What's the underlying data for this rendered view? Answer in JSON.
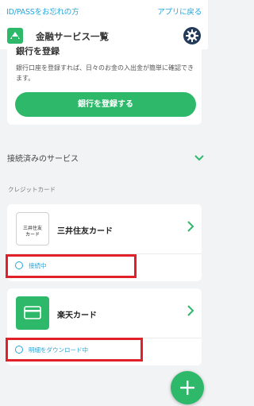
{
  "topbar": {
    "forgot_link": "ID/PASSをお忘れの方",
    "back_link": "アプリに戻る"
  },
  "header": {
    "title": "金融サービス一覧",
    "logo_icon": "app-logo-icon",
    "settings_icon": "gear-icon"
  },
  "bank_card": {
    "heading": "銀行を登録",
    "description": "銀行口座を登録すれば、日々のお金の入出金が簡単に確認できます。",
    "register_button": "銀行を登録する"
  },
  "connected": {
    "label": "接続済みのサービス",
    "icon": "chevron-down-icon"
  },
  "section": {
    "credit_label": "クレジットカード"
  },
  "services": [
    {
      "logo_line1": "三井住友",
      "logo_line2": "カード",
      "name": "三井住友カード",
      "status": "接続中"
    },
    {
      "name": "楽天カード",
      "status": "明細をダウンロード中"
    }
  ],
  "colors": {
    "accent_green": "#2db86a",
    "link_blue": "#27a4d9",
    "highlight_red": "#e0212a",
    "gear_bg": "#233a58"
  }
}
